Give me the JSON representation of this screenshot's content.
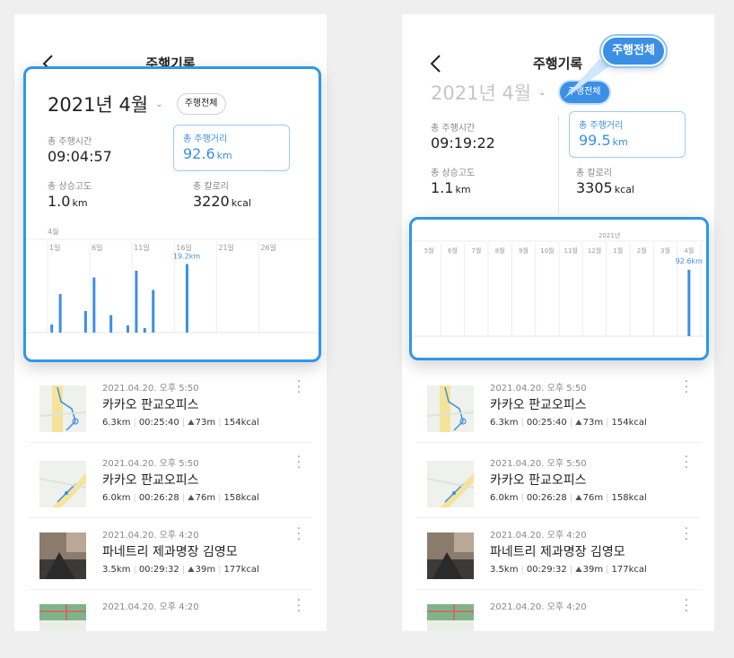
{
  "colors": {
    "accent": "#3b8fe4",
    "highlight_border": "#2f96ea",
    "bar": "#3b8fe4",
    "grid": "#eeeeee"
  },
  "screen_left": {
    "header": {
      "title": "주행기록",
      "back_icon": "chevron-left-icon"
    },
    "summary": {
      "month": "2021년 4월",
      "caret": "⌄",
      "filter_pill": "주행전체",
      "stats": {
        "time": {
          "label": "총 주행시간",
          "value": "09:04:57"
        },
        "distance": {
          "label": "총 주행거리",
          "value": "92.6",
          "unit": "km"
        },
        "climb": {
          "label": "총 상승고도",
          "value": "1.0",
          "unit": "km"
        },
        "calories": {
          "label": "총 칼로리",
          "value": "3220",
          "unit": "kcal"
        }
      }
    },
    "chart_data": {
      "type": "bar",
      "title": "",
      "period_label": "4월",
      "tick_labels": [
        "1일",
        "6일",
        "11일",
        "16일",
        "21일",
        "26일"
      ],
      "annotation": "19.2km",
      "x": [
        1,
        2,
        5,
        6,
        8,
        10,
        11,
        12,
        13,
        17
      ],
      "values": [
        1.8,
        8.6,
        4.8,
        12.3,
        3.9,
        1.6,
        13.8,
        1.0,
        9.5,
        15.3
      ],
      "xlim": [
        0,
        31
      ],
      "ylim": [
        0,
        20
      ]
    },
    "records": [
      {
        "time": "2021.04.20. 오후 5:50",
        "place": "카카오 판교오피스",
        "distance": "6.3km",
        "duration": "00:25:40",
        "climb": "73m",
        "calories": "154kcal",
        "thumb": "map"
      },
      {
        "time": "2021.04.20. 오후 5:50",
        "place": "카카오 판교오피스",
        "distance": "6.0km",
        "duration": "00:26:28",
        "climb": "76m",
        "calories": "158kcal",
        "thumb": "map2"
      },
      {
        "time": "2021.04.20. 오후 4:20",
        "place": "파네트리 제과명장 김영모",
        "distance": "3.5km",
        "duration": "00:29:32",
        "climb": "39m",
        "calories": "177kcal",
        "thumb": "photo"
      },
      {
        "time": "2021.04.20. 오후 4:20",
        "place": "",
        "distance": "",
        "duration": "",
        "climb": "",
        "calories": "",
        "thumb": "map3"
      }
    ]
  },
  "screen_right": {
    "header": {
      "title": "주행기록",
      "filter_pill": "주행전체",
      "back_icon": "chevron-left-icon"
    },
    "summary": {
      "month": "2021년 4월",
      "caret": "⌄",
      "filter_pill": "주행전체",
      "stats": {
        "time": {
          "label": "총 주행시간",
          "value": "09:19:22"
        },
        "distance": {
          "label": "총 주행거리",
          "value": "99.5",
          "unit": "km"
        },
        "climb": {
          "label": "총 상승고도",
          "value": "1.1",
          "unit": "km"
        },
        "calories": {
          "label": "총 칼로리",
          "value": "3305",
          "unit": "kcal"
        }
      }
    },
    "chart_data": {
      "type": "bar",
      "title": "",
      "year_label": "2021년",
      "categories": [
        "5월",
        "6월",
        "7월",
        "8월",
        "9월",
        "10월",
        "11월",
        "12월",
        "1월",
        "2월",
        "3월",
        "4월"
      ],
      "values": [
        0,
        0,
        0,
        0,
        0,
        0,
        0,
        0,
        0,
        0,
        0,
        92.6
      ],
      "annotation": "92.6km",
      "ylim": [
        0,
        100
      ]
    },
    "records": [
      {
        "time": "2021.04.20. 오후 5:50",
        "place": "카카오 판교오피스",
        "distance": "6.3km",
        "duration": "00:25:40",
        "climb": "73m",
        "calories": "154kcal",
        "thumb": "map"
      },
      {
        "time": "2021.04.20. 오후 5:50",
        "place": "카카오 판교오피스",
        "distance": "6.0km",
        "duration": "00:26:28",
        "climb": "76m",
        "calories": "158kcal",
        "thumb": "map2"
      },
      {
        "time": "2021.04.20. 오후 4:20",
        "place": "파네트리 제과명장 김영모",
        "distance": "3.5km",
        "duration": "00:29:32",
        "climb": "39m",
        "calories": "177kcal",
        "thumb": "photo"
      },
      {
        "time": "2021.04.20. 오후 4:20",
        "place": "",
        "distance": "",
        "duration": "",
        "climb": "",
        "calories": "",
        "thumb": "map3"
      }
    ]
  }
}
